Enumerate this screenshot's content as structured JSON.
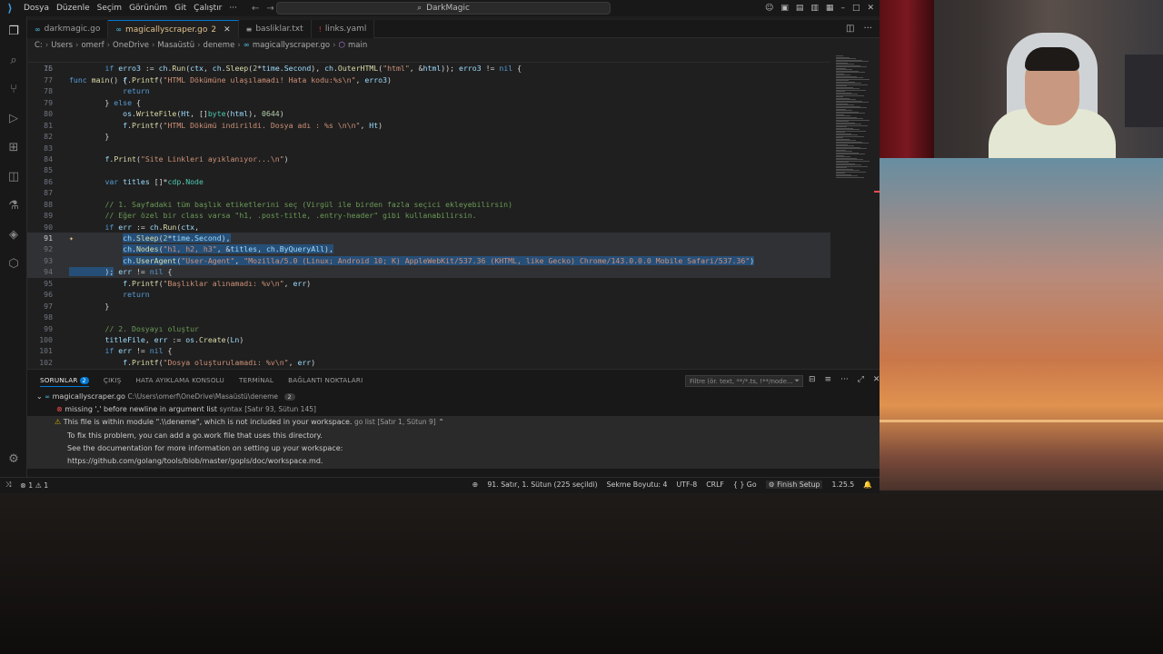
{
  "app": {
    "title": "DarkMagic"
  },
  "menu": [
    "Dosya",
    "Düzenle",
    "Seçim",
    "Görünüm",
    "Git",
    "Çalıştır",
    "···"
  ],
  "tabs": [
    {
      "label": "darkmagic.go",
      "icon": "go-file-icon",
      "active": false,
      "modified": ""
    },
    {
      "label": "magicallyscraper.go",
      "icon": "go-file-icon",
      "active": true,
      "modified": "2"
    },
    {
      "label": "basliklar.txt",
      "icon": "txt-file-icon",
      "active": false,
      "modified": ""
    },
    {
      "label": "links.yaml",
      "icon": "yaml-file-icon",
      "active": false,
      "modified": ""
    }
  ],
  "breadcrumb": [
    "C:",
    "Users",
    "omerf",
    "OneDrive",
    "Masaüstü",
    "deneme",
    "magicallyscraper.go",
    "main"
  ],
  "sticky": {
    "ln": "15",
    "text": "func main() {"
  },
  "code": [
    {
      "ln": "76",
      "cls": "",
      "html": "        <span class='kw'>if</span> <span class='id'>erro3</span> := <span class='id'>ch</span>.<span class='fn'>Run</span>(<span class='id'>ctx</span>, <span class='id'>ch</span>.<span class='fn'>Sleep</span>(<span class='num'>2</span>*<span class='id'>time</span>.<span class='id'>Second</span>), <span class='id'>ch</span>.<span class='fn'>OuterHTML</span>(<span class='str'>\"html\"</span>, &amp;<span class='id'>html</span>)); <span class='id'>erro3</span> != <span class='kw'>nil</span> {"
    },
    {
      "ln": "77",
      "cls": "",
      "html": "            <span class='id'>f</span>.<span class='fn'>Printf</span>(<span class='str'>\"HTML Dökümüne ulaşılamadı! Hata kodu:%s\\n\"</span>, <span class='id'>erro3</span>)"
    },
    {
      "ln": "78",
      "cls": "",
      "html": "            <span class='kw'>return</span>"
    },
    {
      "ln": "79",
      "cls": "",
      "html": "        } <span class='kw'>else</span> {"
    },
    {
      "ln": "80",
      "cls": "",
      "html": "            <span class='id'>os</span>.<span class='fn'>WriteFile</span>(<span class='id'>Ht</span>, []<span class='ty'>byte</span>(<span class='id'>html</span>), <span class='num'>0644</span>)"
    },
    {
      "ln": "81",
      "cls": "",
      "html": "            <span class='id'>f</span>.<span class='fn'>Printf</span>(<span class='str'>\"HTML Dökümü indirildi. Dosya adı : %s \\n\\n\"</span>, <span class='id'>Ht</span>)"
    },
    {
      "ln": "82",
      "cls": "",
      "html": "        }"
    },
    {
      "ln": "83",
      "cls": "",
      "html": ""
    },
    {
      "ln": "84",
      "cls": "",
      "html": "        <span class='id'>f</span>.<span class='fn'>Print</span>(<span class='str'>\"Site Linkleri ayıklanıyor...\\n\"</span>)"
    },
    {
      "ln": "85",
      "cls": "",
      "html": ""
    },
    {
      "ln": "86",
      "cls": "",
      "html": "        <span class='kw'>var</span> <span class='id'>titles</span> []*<span class='ty'>cdp</span>.<span class='ty'>Node</span>"
    },
    {
      "ln": "87",
      "cls": "",
      "html": ""
    },
    {
      "ln": "88",
      "cls": "",
      "html": "        <span class='cm'>// 1. Sayfadaki tüm başlık etiketlerini seç (Virgül ile birden fazla seçici ekleyebilirsin)</span>"
    },
    {
      "ln": "89",
      "cls": "",
      "html": "        <span class='cm'>// Eğer özel bir class varsa \"h1, .post-title, .entry-header\" gibi kullanabilirsin.</span>"
    },
    {
      "ln": "90",
      "cls": "",
      "html": "        <span class='kw'>if</span> <span class='id'>err</span> := <span class='id'>ch</span>.<span class='fn'>Run</span>(<span class='id'>ctx</span>,"
    },
    {
      "ln": "91",
      "cls": "sel cur",
      "html": "            <span class='hl'><span class='id'>ch</span>.<span class='fn'>Sleep</span>(<span class='num'>2</span>*<span class='id'>time</span>.<span class='id'>Second</span>),</span>"
    },
    {
      "ln": "92",
      "cls": "sel",
      "html": "            <span class='hl'><span class='id'>ch</span>.<span class='fn'>Nodes</span>(<span class='str'>\"h1, h2, h3\"</span>, &amp;<span class='id'>titles</span>, <span class='id'>ch</span>.<span class='id'>ByQueryAll</span>),</span>"
    },
    {
      "ln": "93",
      "cls": "sel",
      "html": "            <span class='hl'><span class='id'>ch</span>.<span class='fn'>UserAgent</span>(<span class='str'>\"User-Agent\"</span>, <span class='str'>\"Mozilla/5.0 (Linux; Android 10; K) AppleWebKit/537.36 (KHTML, like Gecko) Chrome/143.0.0.0 Mobile Safari/537.36\"</span>)</span>"
    },
    {
      "ln": "94",
      "cls": "sel",
      "html": "<span class='hl'>        );</span> <span class='id'>err</span> != <span class='kw'>nil</span> {"
    },
    {
      "ln": "95",
      "cls": "",
      "html": "            <span class='id'>f</span>.<span class='fn'>Printf</span>(<span class='str'>\"Başlıklar alınamadı: %v\\n\"</span>, <span class='id'>err</span>)"
    },
    {
      "ln": "96",
      "cls": "",
      "html": "            <span class='kw'>return</span>"
    },
    {
      "ln": "97",
      "cls": "",
      "html": "        }"
    },
    {
      "ln": "98",
      "cls": "",
      "html": ""
    },
    {
      "ln": "99",
      "cls": "",
      "html": "        <span class='cm'>// 2. Dosyayı oluştur</span>"
    },
    {
      "ln": "100",
      "cls": "",
      "html": "        <span class='id'>titleFile</span>, <span class='id'>err</span> := <span class='id'>os</span>.<span class='fn'>Create</span>(<span class='id'>Ln</span>)"
    },
    {
      "ln": "101",
      "cls": "",
      "html": "        <span class='kw'>if</span> <span class='id'>err</span> != <span class='kw'>nil</span> {"
    },
    {
      "ln": "102",
      "cls": "",
      "html": "            <span class='id'>f</span>.<span class='fn'>Printf</span>(<span class='str'>\"Dosya oluşturulamadı: %v\\n\"</span>, <span class='id'>err</span>)"
    }
  ],
  "panel": {
    "tabs": [
      {
        "label": "SORUNLAR",
        "badge": "2",
        "active": true
      },
      {
        "label": "ÇIKIŞ",
        "badge": "",
        "active": false
      },
      {
        "label": "HATA AYIKLAMA KONSOLU",
        "badge": "",
        "active": false
      },
      {
        "label": "TERMİNAL",
        "badge": "",
        "active": false
      },
      {
        "label": "BAĞLANTI NOKTALARI",
        "badge": "",
        "active": false
      }
    ],
    "filter_placeholder": "Filtre (ör. text, **/*.ts, !**/node...",
    "file": {
      "name": "magicallyscraper.go",
      "path": "C:\\Users\\omerf\\OneDrive\\Masaüstü\\deneme",
      "count": "2"
    },
    "error": {
      "msg": "missing ',' before newline in argument list",
      "source": "syntax",
      "loc": "[Satır 93, Sütun 145]"
    },
    "warning": {
      "msg": "This file is within module \".\\\\deneme\", which is not included in your workspace.",
      "source": "go list",
      "loc": "[Satır 1, Sütun 9]"
    },
    "warning_details": [
      "To fix this problem, you can add a go.work file that uses this directory.",
      "See the documentation for more information on setting up your workspace:",
      "https://github.com/golang/tools/blob/master/gopls/doc/workspace.md."
    ]
  },
  "status": {
    "errors": "1",
    "warnings": "1",
    "position": "91. Satır, 1. Sütun (225 seçildi)",
    "indent": "Sekme Boyutu: 4",
    "encoding": "UTF-8",
    "eol": "CRLF",
    "language": "Go",
    "setup": "Finish Setup",
    "version": "1.25.5"
  },
  "colors": {
    "accent": "#0078d4",
    "error": "#f14c4c",
    "warning": "#cca700"
  }
}
